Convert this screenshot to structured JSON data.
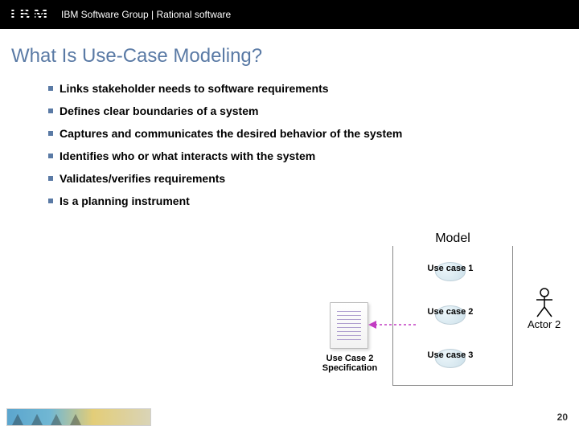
{
  "header": {
    "logo_text": "IBM",
    "breadcrumb": "IBM Software Group | Rational software"
  },
  "title": "What Is Use-Case Modeling?",
  "bullets": [
    "Links stakeholder needs to software requirements",
    "Defines clear boundaries of a system",
    "Captures and communicates the desired behavior of the system",
    "Identifies who or what interacts with the system",
    "Validates/verifies requirements",
    "Is a planning instrument"
  ],
  "diagram": {
    "model_label": "Model",
    "usecases": {
      "uc1": "Use case 1",
      "uc2": "Use case 2",
      "uc3": "Use case 3"
    },
    "actor_label": "Actor 2",
    "spec_label": "Use Case 2 Specification"
  },
  "footer": {
    "page": "20"
  }
}
